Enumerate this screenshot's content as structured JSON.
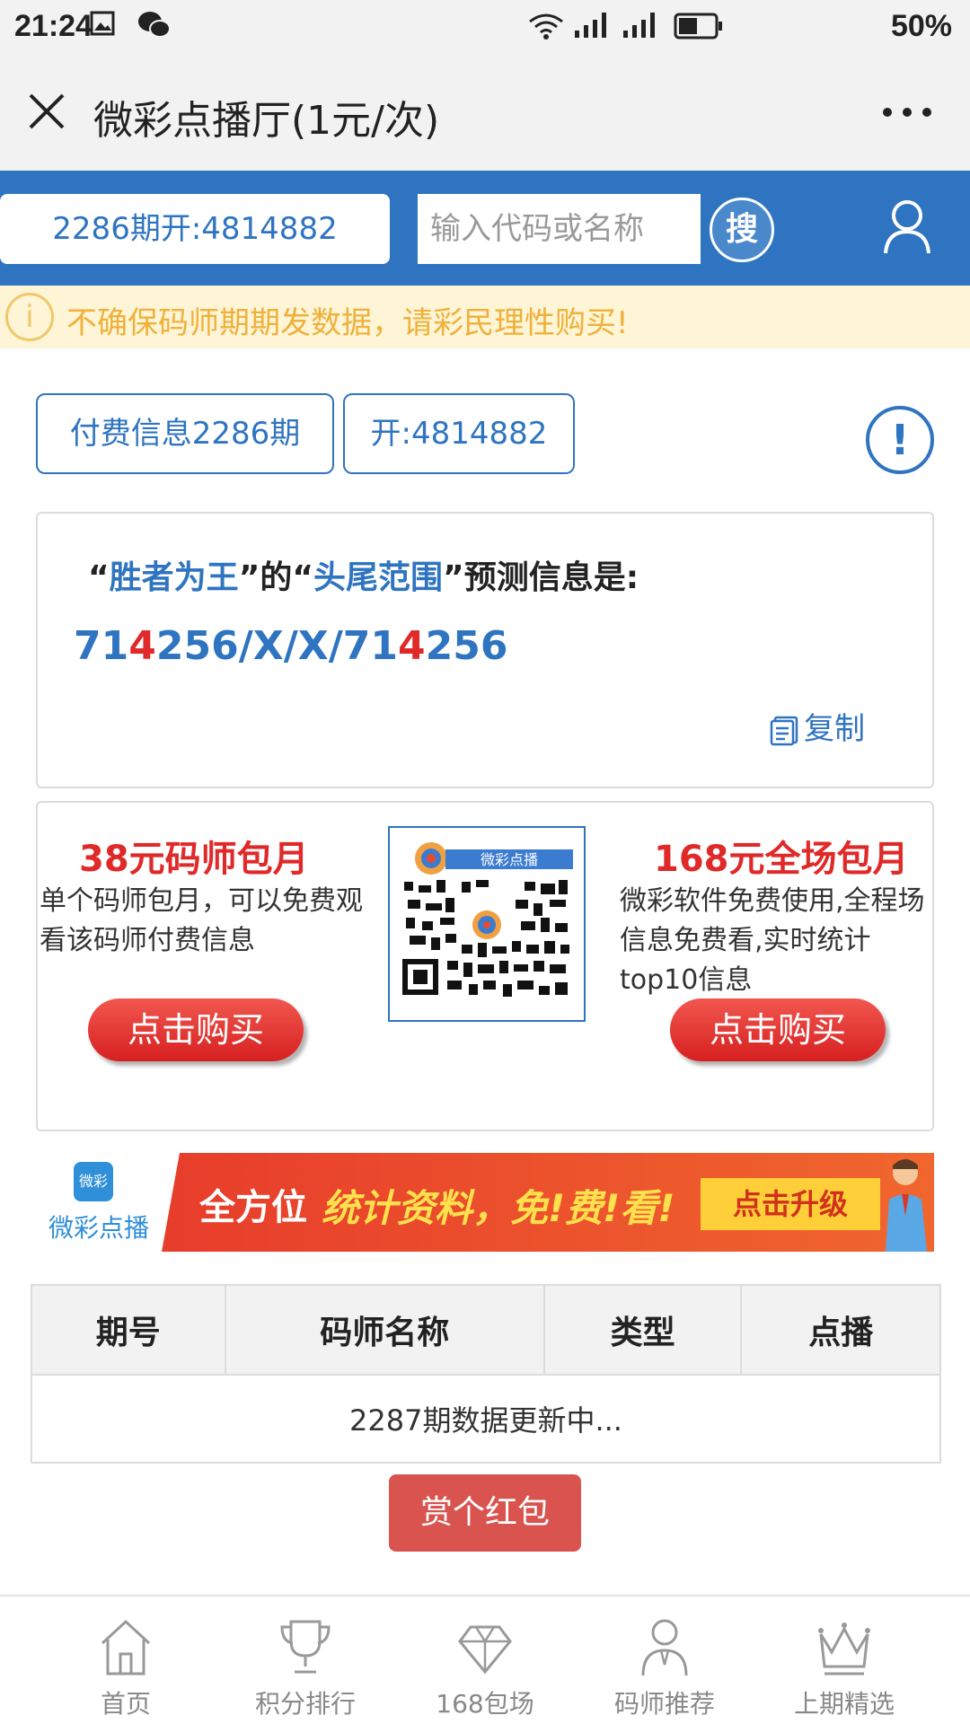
{
  "status_bar": {
    "time": "21:24",
    "battery": "50%"
  },
  "title_bar": {
    "title": "微彩点播厅(1元/次)"
  },
  "header": {
    "period_open": "2286期开:4814882",
    "search_placeholder": "输入代码或名称",
    "search_button": "搜"
  },
  "warning": {
    "text": "不确保码师期期发数据，请彩民理性购买!"
  },
  "info_buttons": {
    "paid": "付费信息2286期",
    "open": "开:4814882"
  },
  "prediction": {
    "quote_open1": "“",
    "name": "胜者为王",
    "quote_close1": "”的“",
    "category": "头尾范围",
    "quote_close2": "”预测信息是:",
    "value_parts": [
      "71",
      "4",
      "256/X/X/71",
      "4",
      "256"
    ],
    "copy_label": "复制"
  },
  "promo": {
    "left": {
      "title": "38元码师包月",
      "desc": "单个码师包月，可以免费观看该码师付费信息",
      "button": "点击购买"
    },
    "right": {
      "title": "168元全场包月",
      "desc": "微彩软件免费使用,全程场信息免费看,实时统计top10信息",
      "button": "点击购买"
    },
    "qr_caption": "微彩点播"
  },
  "banner": {
    "logo_top": "微彩",
    "logo_bottom": "微彩点播",
    "text1": "全方位",
    "text2": "统计资料，免!费!看!",
    "upgrade": "点击升级"
  },
  "table": {
    "headers": [
      "期号",
      "码师名称",
      "类型",
      "点播"
    ],
    "status_row": "2287期数据更新中..."
  },
  "reward_button": "赏个红包",
  "bottom_nav": [
    {
      "label": "首页",
      "icon": "home-icon"
    },
    {
      "label": "积分排行",
      "icon": "trophy-icon"
    },
    {
      "label": "168包场",
      "icon": "diamond-icon"
    },
    {
      "label": "码师推荐",
      "icon": "person-icon"
    },
    {
      "label": "上期精选",
      "icon": "crown-icon"
    }
  ],
  "colors": {
    "brand_blue": "#2f74c0",
    "accent_red": "#e02a2a",
    "warning_yellow": "#f0b03a"
  }
}
